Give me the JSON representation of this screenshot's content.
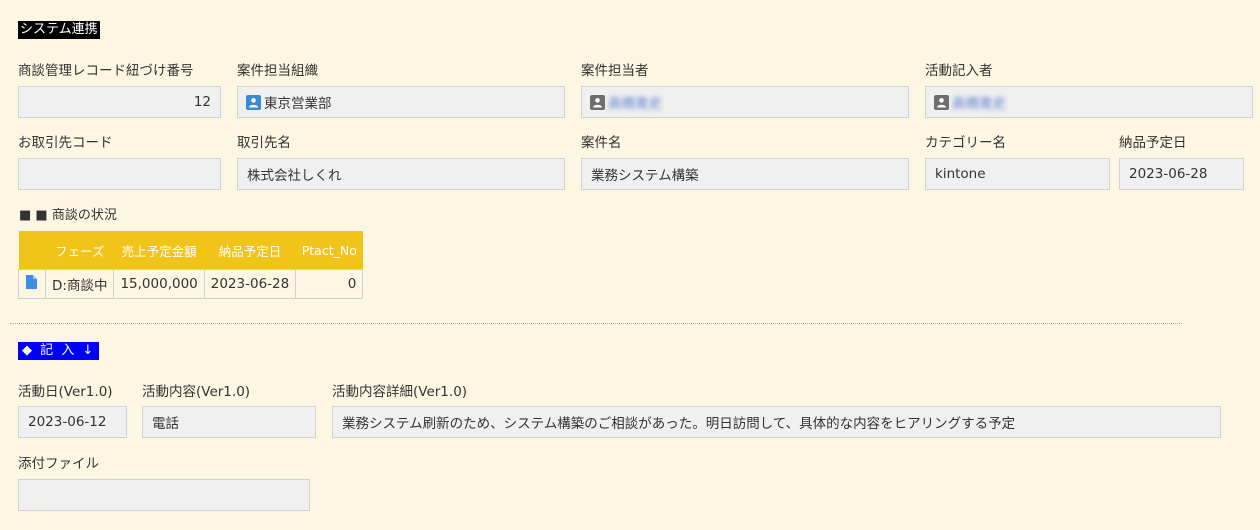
{
  "sections": {
    "system": "システム連携",
    "status": "■ ■ 商談の状況",
    "entry": "◆ 記 入 ↓"
  },
  "fields": {
    "deal_id": {
      "label": "商談管理レコード紐づけ番号",
      "value": "12"
    },
    "org": {
      "label": "案件担当組織",
      "value": "東京営業部"
    },
    "owner": {
      "label": "案件担当者",
      "value": "高橋寛史"
    },
    "recorder": {
      "label": "活動記入者",
      "value": "高橋寛史"
    },
    "client_code": {
      "label": "お取引先コード",
      "value": ""
    },
    "client_name": {
      "label": "取引先名",
      "value": "株式会社しくれ"
    },
    "project": {
      "label": "案件名",
      "value": "業務システム構築"
    },
    "category": {
      "label": "カテゴリー名",
      "value": "kintone"
    },
    "delivery": {
      "label": "納品予定日",
      "value": "2023-06-28"
    },
    "activity_date": {
      "label": "活動日(Ver1.0)",
      "value": "2023-06-12"
    },
    "activity_content": {
      "label": "活動内容(Ver1.0)",
      "value": "電話"
    },
    "activity_detail": {
      "label": "活動内容詳細(Ver1.0)",
      "value": "業務システム刷新のため、システム構築のご相談があった。明日訪問して、具体的な内容をヒアリングする予定"
    },
    "attachment": {
      "label": "添付ファイル",
      "value": ""
    }
  },
  "table": {
    "headers": [
      "フェーズ",
      "売上予定金額",
      "納品予定日",
      "Ptact_No"
    ],
    "row": [
      "D:商談中",
      "15,000,000",
      "2023-06-28",
      "0"
    ]
  },
  "colors": {
    "background": "#fcf6e3",
    "system_title_bg": "#000000",
    "entry_title_bg": "#0000ff",
    "table_header": "#f0c418",
    "org_icon": "#3b8bd0",
    "user_icon": "#6e6e6e",
    "doc_icon": "#3a8ee6"
  },
  "icons": [
    "organization-icon",
    "user-icon",
    "document-icon"
  ]
}
